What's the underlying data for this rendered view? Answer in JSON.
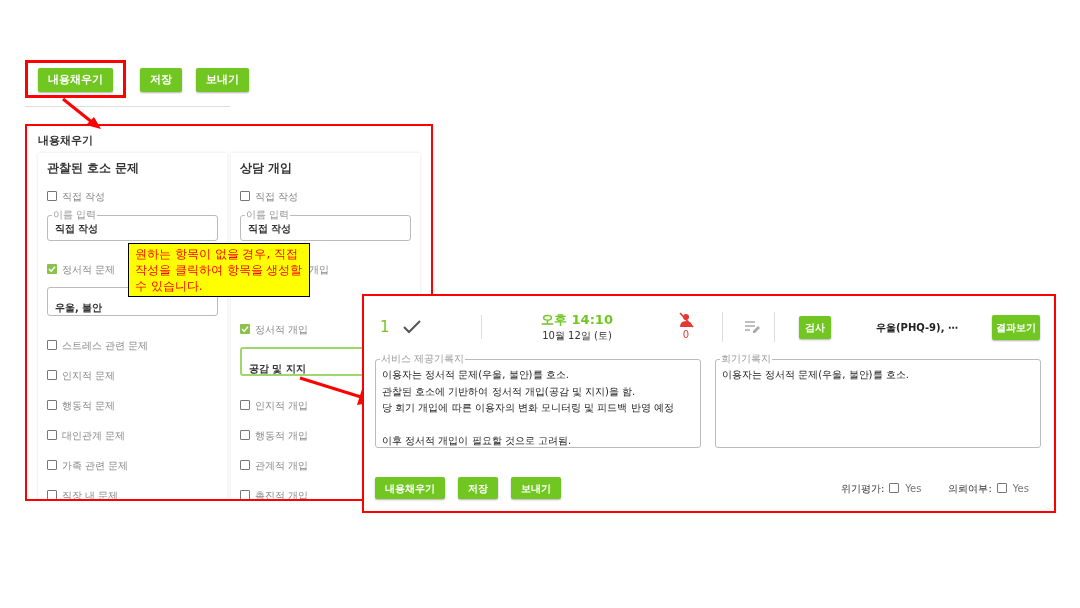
{
  "toolbar": {
    "buttons": [
      {
        "label": "내용채우기",
        "highlighted": true
      },
      {
        "label": "저장",
        "highlighted": false
      },
      {
        "label": "보내기",
        "highlighted": false
      }
    ]
  },
  "fill_panel": {
    "title": "내용채우기",
    "columns": [
      {
        "title": "관찰된 호소 문제",
        "items": [
          {
            "kind": "checkbox",
            "label": "직접 작성",
            "checked": false
          },
          {
            "kind": "field",
            "label": "이름 입력",
            "value": "직접 작성"
          },
          {
            "kind": "checkbox",
            "label": "정서적 문제",
            "checked": true
          },
          {
            "kind": "textarea",
            "value": "우울, 불안",
            "focused": false
          },
          {
            "kind": "checkbox",
            "label": "스트레스 관련 문제",
            "checked": false
          },
          {
            "kind": "checkbox",
            "label": "인지적 문제",
            "checked": false
          },
          {
            "kind": "checkbox",
            "label": "행동적 문제",
            "checked": false
          },
          {
            "kind": "checkbox",
            "label": "대인관계 문제",
            "checked": false
          },
          {
            "kind": "checkbox",
            "label": "가족 관련 문제",
            "checked": false
          },
          {
            "kind": "checkbox",
            "label": "직장 내 문제",
            "checked": false
          }
        ]
      },
      {
        "title": "상담 개입",
        "items": [
          {
            "kind": "checkbox",
            "label": "직접 작성",
            "checked": false
          },
          {
            "kind": "field",
            "label": "이름 입력",
            "value": "직접 작성"
          },
          {
            "kind": "partial",
            "label": "개입"
          },
          {
            "kind": "covered"
          },
          {
            "kind": "checkbox",
            "label": "정서적 개입",
            "checked": true
          },
          {
            "kind": "textarea",
            "value": "공감 및 지지",
            "focused": true
          },
          {
            "kind": "checkbox",
            "label": "인지적 개입",
            "checked": false
          },
          {
            "kind": "checkbox",
            "label": "행동적 개입",
            "checked": false
          },
          {
            "kind": "checkbox",
            "label": "관계적 개입",
            "checked": false
          },
          {
            "kind": "checkbox",
            "label": "촉진적 개입",
            "checked": false
          }
        ]
      }
    ]
  },
  "callout": {
    "text": "원하는 항목이 없을 경우, 직접 작성을 클릭하여 항목을 생성할 수 있습니다."
  },
  "record_panel": {
    "number": "1",
    "time": "오후 14:10",
    "date": "10월 12일 (토)",
    "missed_count": "0",
    "test_button": "검사",
    "test_summary": "우울(PHQ-9), ⋯",
    "result_button": "결과보기",
    "notes": [
      {
        "label": "서비스 제공기록지",
        "value": "이용자는 정서적 문제(우울, 불안)를 호소.\n관찰된 호소에 기반하여 정서적 개입(공감 및 지지)을 함.\n당 회기 개입에 따른 이용자의 변화 모니터링 및 피드백 반영 예정\n\n이후 정서적 개입이 필요할 것으로 고려됨."
      },
      {
        "label": "회기기록지",
        "value": "이용자는 정서적 문제(우울, 불안)를 호소."
      }
    ],
    "buttons": [
      "내용채우기",
      "저장",
      "보내기"
    ],
    "checks": [
      {
        "label": "위기평가:",
        "option": "Yes",
        "checked": false
      },
      {
        "label": "의뢰여부:",
        "option": "Yes",
        "checked": false
      }
    ]
  }
}
